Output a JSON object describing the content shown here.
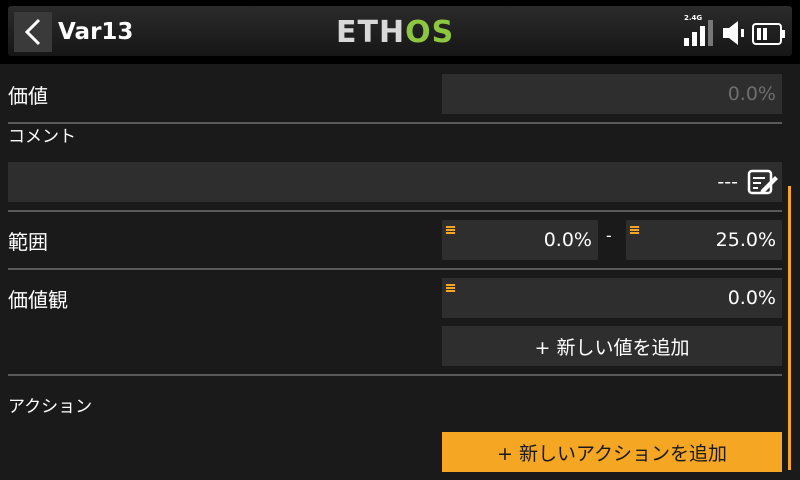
{
  "header": {
    "title": "Var13",
    "logo": "ETHOS",
    "logo_main": "ETH",
    "logo_accent": "OS",
    "rf_band": "2.4G"
  },
  "rows": {
    "value": {
      "label": "価値",
      "field": "0.0%"
    },
    "comment": {
      "label": "コメント",
      "field": "---"
    },
    "range": {
      "label": "範囲",
      "min": "0.0%",
      "separator": "-",
      "max": "25.0%"
    },
    "values": {
      "label": "価値観",
      "field": "0.0%",
      "add_button": "+ 新しい値を追加"
    },
    "actions": {
      "label": "アクション",
      "add_button": "+ 新しいアクションを追加"
    }
  },
  "colors": {
    "accent": "#f5a623",
    "logo_green": "#8dc63f",
    "field_bg": "#2e2e2e"
  }
}
